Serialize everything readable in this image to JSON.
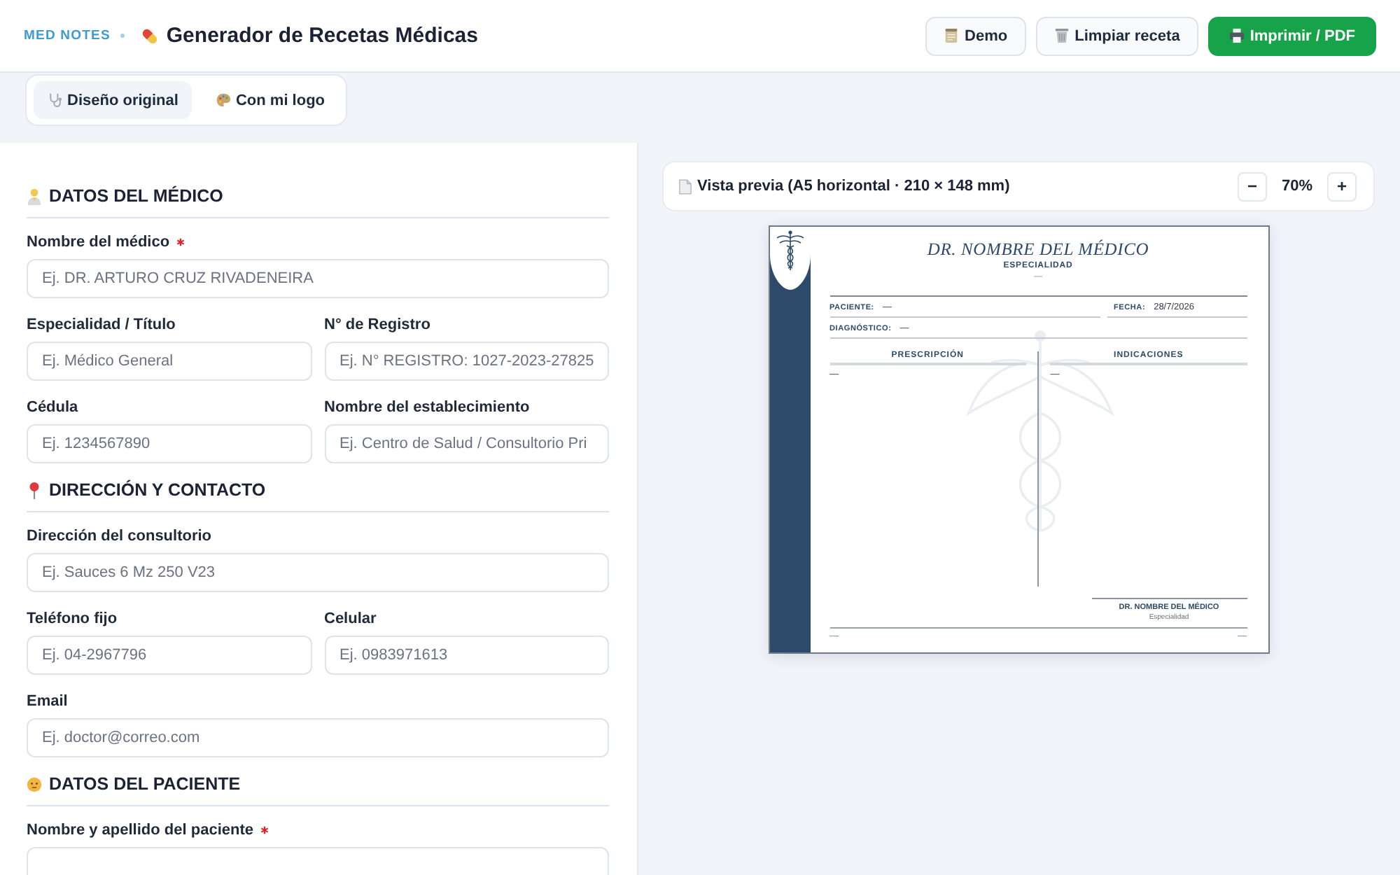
{
  "header": {
    "brand": "MED NOTES",
    "title": "Generador de Recetas Médicas",
    "buttons": [
      {
        "label": "Demo",
        "kind": "demo"
      },
      {
        "label": "Limpiar receta",
        "kind": "clear"
      },
      {
        "label": "Imprimir / PDF",
        "kind": "print"
      }
    ]
  },
  "design_tabs": [
    {
      "label": "Diseño original",
      "kind": "original",
      "selected": true
    },
    {
      "label": "Con mi logo",
      "kind": "logo",
      "selected": false
    }
  ],
  "form": {
    "sections": [
      {
        "title": "DATOS DEL MÉDICO",
        "kind": "doctor",
        "rows": [
          [
            {
              "label": "Nombre del médico",
              "required": true,
              "placeholder": "Ej. DR. ARTURO CRUZ RIVADENEIRA"
            }
          ],
          [
            {
              "label": "Especialidad / Título",
              "required": false,
              "placeholder": "Ej. Médico General"
            },
            {
              "label": "N° de Registro",
              "required": false,
              "placeholder": "Ej. N° REGISTRO: 1027-2023-27825"
            }
          ],
          [
            {
              "label": "Cédula",
              "required": false,
              "placeholder": "Ej. 1234567890"
            },
            {
              "label": "Nombre del establecimiento",
              "required": false,
              "placeholder": "Ej. Centro de Salud / Consultorio Pri"
            }
          ]
        ]
      },
      {
        "title": "DIRECCIÓN Y CONTACTO",
        "kind": "contact",
        "rows": [
          [
            {
              "label": "Dirección del consultorio",
              "required": false,
              "placeholder": "Ej. Sauces 6 Mz 250 V23"
            }
          ],
          [
            {
              "label": "Teléfono fijo",
              "required": false,
              "placeholder": "Ej. 04-2967796"
            },
            {
              "label": "Celular",
              "required": false,
              "placeholder": "Ej. 0983971613"
            }
          ],
          [
            {
              "label": "Email",
              "required": false,
              "placeholder": "Ej. doctor@correo.com"
            }
          ]
        ]
      },
      {
        "title": "DATOS DEL PACIENTE",
        "kind": "patient",
        "rows": [
          [
            {
              "label": "Nombre y apellido del paciente",
              "required": true
            }
          ]
        ]
      }
    ]
  },
  "preview": {
    "title": "Vista previa (A5 horizontal · 210 × 148 mm)",
    "zoom": {
      "decrease": "−",
      "value": "70%",
      "increase": "+"
    },
    "sheet": {
      "doctor_name": "DR. NOMBRE DEL MÉDICO",
      "specialty": "ESPECIALIDAD",
      "subtitle": "—",
      "patient": {
        "label": "PACIENTE:",
        "value": "—"
      },
      "date": {
        "label": "FECHA:",
        "value": "28/7/2026"
      },
      "diagnosis": {
        "label": "DIAGNÓSTICO:",
        "value": "—"
      },
      "columns": [
        {
          "title": "PRESCRIPCIÓN",
          "body": "—"
        },
        {
          "title": "INDICACIONES",
          "body": "—"
        }
      ],
      "signature": {
        "name": "DR. NOMBRE DEL MÉDICO",
        "specialty": "Especialidad"
      },
      "footer": {
        "left": "—",
        "right": "—"
      }
    }
  }
}
